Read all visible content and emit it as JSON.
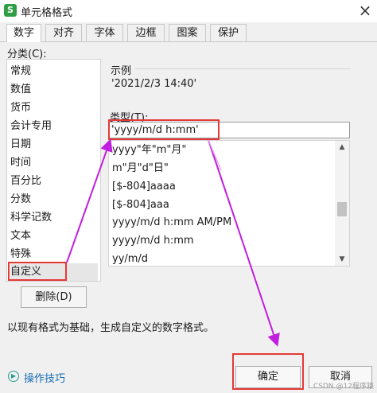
{
  "window": {
    "title": "单元格格式",
    "app_icon_glyph": "S",
    "close_glyph": "×"
  },
  "tabs": [
    {
      "label": "数字",
      "active": true
    },
    {
      "label": "对齐"
    },
    {
      "label": "字体"
    },
    {
      "label": "边框"
    },
    {
      "label": "图案"
    },
    {
      "label": "保护"
    }
  ],
  "category": {
    "label": "分类(C):",
    "items": [
      "常规",
      "数值",
      "货币",
      "会计专用",
      "日期",
      "时间",
      "百分比",
      "分数",
      "科学记数",
      "文本",
      "特殊",
      "自定义"
    ],
    "selected": "自定义"
  },
  "delete_button": "删除(D)",
  "sample": {
    "label": "示例",
    "value": "'2021/2/3 14:40'"
  },
  "type": {
    "label": "类型(T):",
    "value": "'yyyy/m/d h:mm'"
  },
  "format_list": [
    "yyyy\"年\"m\"月\"",
    "m\"月\"d\"日\"",
    "[$-804]aaaa",
    "[$-804]aaa",
    "yyyy/m/d h:mm AM/PM",
    "yyyy/m/d h:mm",
    "yy/m/d"
  ],
  "description": "以现有格式为基础，生成自定义的数字格式。",
  "bottom": {
    "tips_link": "操作技巧",
    "ok_button": "确定",
    "cancel_button": "取消",
    "watermark": "CSDN @12程序猿"
  },
  "icons": {
    "app": "spreadsheet-app-icon",
    "close": "close-icon",
    "scroll_up": "chevron-up-icon",
    "scroll_down": "chevron-down-icon",
    "tips": "play-circle-icon"
  },
  "colors": {
    "annotation": "#e53935",
    "arrow": "#c21ee0",
    "link": "#1a6fb5"
  }
}
